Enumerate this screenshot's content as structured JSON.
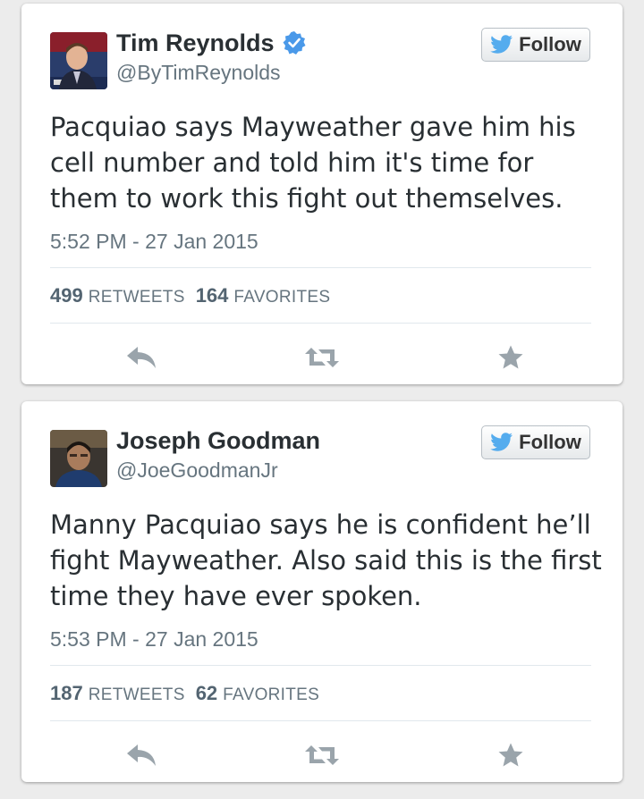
{
  "colors": {
    "background": "#ececec",
    "card": "#ffffff",
    "text": "#292f33",
    "muted": "#66757f",
    "twitter_blue": "#55acee",
    "verified_blue": "#4a99e9",
    "action_gray": "#9aa4ab"
  },
  "follow_label": "Follow",
  "icons": {
    "avatar": "avatar",
    "verified": "verified-badge-icon",
    "bird": "twitter-bird-icon",
    "reply": "reply-icon",
    "retweet": "retweet-icon",
    "favorite": "star-icon"
  },
  "tweets": [
    {
      "name": "Tim Reynolds",
      "verified": true,
      "handle": "@ByTimReynolds",
      "text": "Pacquiao says Mayweather gave him his cell number and told him it's time for them to work this fight out themselves.",
      "timestamp": "5:52 PM - 27 Jan 2015",
      "retweets": "499",
      "retweets_label": "RETWEETS",
      "favorites": "164",
      "favorites_label": "FAVORITES"
    },
    {
      "name": "Joseph Goodman",
      "verified": false,
      "handle": "@JoeGoodmanJr",
      "text": "Manny Pacquiao says he is confident he’ll fight Mayweather. Also said this is the first time they have ever spoken.",
      "timestamp": "5:53 PM - 27 Jan 2015",
      "retweets": "187",
      "retweets_label": "RETWEETS",
      "favorites": "62",
      "favorites_label": "FAVORITES"
    }
  ]
}
